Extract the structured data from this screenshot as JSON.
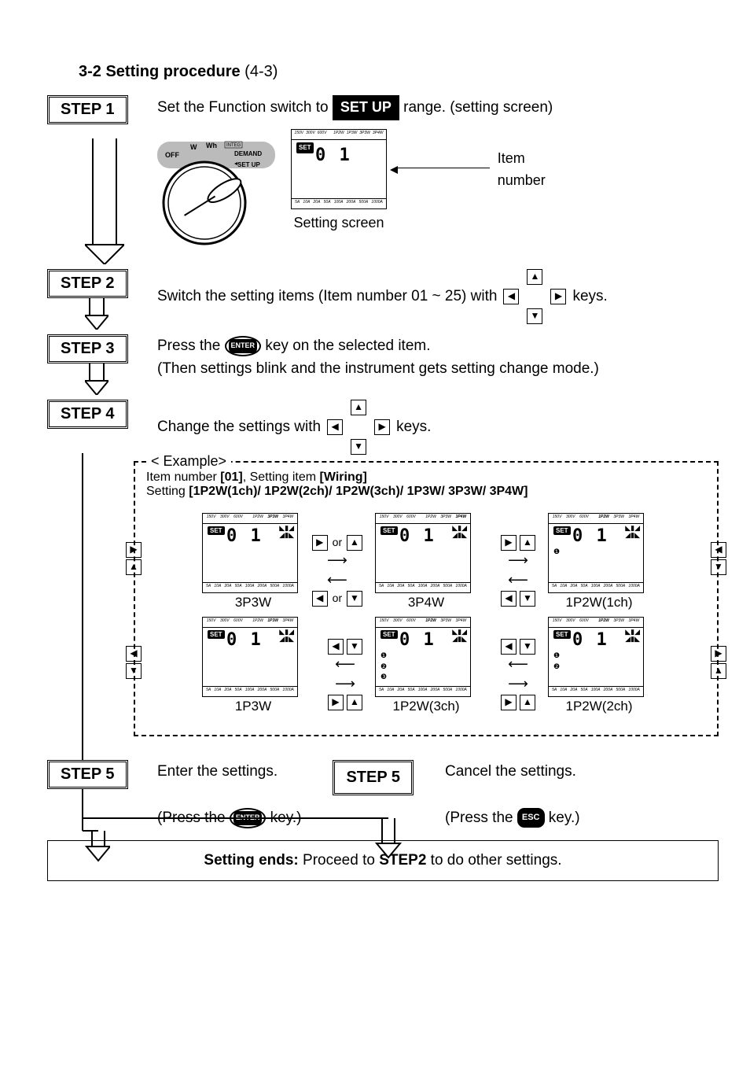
{
  "heading": {
    "number": "3-2",
    "title": "Setting procedure",
    "page": "(4-3)"
  },
  "steps": {
    "s1": {
      "label": "STEP 1",
      "text_a": "Set the Function switch to ",
      "badge": "SET UP",
      "text_b": " range. (setting screen)",
      "item_number_label": "Item number",
      "screen_caption": "Setting screen",
      "digits": "0 1"
    },
    "s2": {
      "label": "STEP 2",
      "text_a": "Switch the setting items (Item number 01 ~ 25) with ",
      "text_b": " keys."
    },
    "s3": {
      "label": "STEP 3",
      "text_a": "Press the ",
      "text_b": " key on the selected item.",
      "text_c": "(Then settings blink and the instrument gets setting change mode.)"
    },
    "s4": {
      "label": "STEP 4",
      "text_a": "Change the settings with ",
      "text_b": " keys."
    },
    "example": {
      "label": "< Example>",
      "line1_a": "Item number ",
      "line1_b": "[01]",
      "line1_c": ", Setting item ",
      "line1_d": "[Wiring]",
      "line2_a": "Setting ",
      "line2_b": "[1P2W(1ch)/ 1P2W(2ch)/ 1P2W(3ch)/ 1P3W/ 3P3W/ 3P4W]",
      "or": "or",
      "digits": "0 1",
      "captions": {
        "r1c1": "3P3W",
        "r1c2": "3P4W",
        "r1c3": "1P2W(1ch)",
        "r2c1": "1P3W",
        "r2c2": "1P2W(3ch)",
        "r2c3": "1P2W(2ch)"
      }
    },
    "s5a": {
      "label": "STEP 5",
      "text_a": "Enter the settings.",
      "text_b": "(Press the ",
      "text_c": " key.)",
      "enter": "ENTER"
    },
    "s5b": {
      "label": "STEP 5",
      "text_a": "Cancel the settings.",
      "text_b": "(Press the ",
      "text_c": " key.)",
      "esc": "ESC"
    },
    "final": {
      "a": "Setting ends:",
      "b": " Proceed to ",
      "c": "STEP2",
      "d": " to do other settings."
    }
  },
  "device": {
    "dial_labels": {
      "off": "OFF",
      "w": "W",
      "wh": "Wh",
      "integ": "INTEG",
      "demand": "DEMAND",
      "setup": "SET UP"
    },
    "voltages": [
      "150V",
      "300V",
      "600V"
    ],
    "wirings": [
      "1P2W",
      "1P3W",
      "3P3W",
      "3P4W"
    ],
    "amps": [
      "5A",
      "10A",
      "20A",
      "50A",
      "100A",
      "200A",
      "500A",
      "1000A"
    ]
  }
}
